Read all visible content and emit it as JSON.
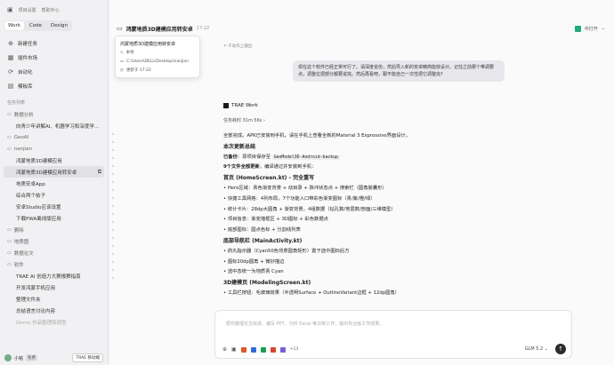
{
  "sidebar": {
    "top_text_1": "项目设置",
    "top_text_2": "帮助中心",
    "modes": [
      "Work",
      "Code",
      "Design"
    ],
    "nav": [
      {
        "label": "新建任务",
        "icon": "new-task-icon",
        "glyph": "⊕"
      },
      {
        "label": "插件市场",
        "icon": "plugin-market-icon",
        "glyph": "▦"
      },
      {
        "label": "自动化",
        "icon": "automation-icon",
        "glyph": "⟳"
      },
      {
        "label": "模板库",
        "icon": "template-icon",
        "glyph": "▤"
      }
    ],
    "list_title": "任务列表",
    "groups": [
      {
        "name": "数据分析",
        "items": [
          "向青少年讲解AI、机器学习和深度学..."
        ]
      },
      {
        "name": "GeoAI",
        "items": []
      },
      {
        "name": "nanjian",
        "items": [
          "鸿蒙地质3D建模应用",
          "鸿蒙地质3D建模应用转安卓",
          "地质安卓App",
          "综合两个帖子",
          "安卓Studio应该设置",
          "下载PWA离线版应用"
        ]
      },
      {
        "name": "删除",
        "items": []
      },
      {
        "name": "地质图",
        "items": []
      },
      {
        "name": "数据论文",
        "items": []
      },
      {
        "name": "软件",
        "items": [
          "TRAE AI 创造力大赛报赛指南",
          "开发鸿蒙手机应用",
          "整理文件夹",
          "总结语言讨论内容",
          "Demo 作品整理和调查"
        ]
      }
    ],
    "active_item": "鸿蒙地质3D建模应用转安卓",
    "user": "小铭",
    "user_badge": "免费",
    "plan_button": "TRAE 移动端"
  },
  "header": {
    "title": "鸿蒙地质3D建模应用转安卓",
    "time": "17:22",
    "open_label": "中打开"
  },
  "tooltip": {
    "title": "鸿蒙地质3D建模应用转安卓",
    "location": "本地",
    "path": "C:\\Users\\DELL\\Desktop\\nanjian",
    "updated": "更新于 17:22"
  },
  "chat": {
    "undo": "↶ 干动作上输出",
    "user_message": "现在这个软件已经正常可行了。请深度省份，然后导入新的安卓精简能效设计。记住之前那个带调要点，调整位把部分都要说完。然后再看吧，跟不能自己一次性把它调整完?",
    "assistant": "TRAE Work",
    "duration": "任务耗时 31m 56s ›",
    "intro": "全部完成。APK已安装到手机，请在手机上查看全新的Material 3 Expressive界面设计。",
    "h_summary": "本次更新总结",
    "pushed_label": "已备份",
    "pushed_text": "：原项目保存至",
    "pushed_code": "GeoModel3D-Android-backup",
    "files_label": "9个文件全部更新",
    "files_text": "，编译通过并安装到手机：",
    "h_home": "首页 (HomeScreen.kt) - 完全重写",
    "home_items": [
      "Hero区域：青色渐变背景 + 动目录 + 脉冲状态点 + 搜索栏（圆角胶囊形）",
      "快捷工具网格：4列布局，7个功能入口带彩色渐变图标（青/紫/橙/绿）",
      "统计卡片：28dp大圆角 + 渐变背景，4组数据（钻孔数/地层数/剖面/三维模型）",
      "项目信息：渐变描框区 + 3D图标 + 彩色数据点",
      "底部图标：圆点色标 + 分割线列表"
    ],
    "h_nav": "底部导航栏 (MainActivity.kt)",
    "nav_items": [
      "药丸指示器（Cyan50色背景圆角矩形）置于选中图标后方",
      "图标20dp圆角 + 微妙描边",
      "选中态统一为地质青 Cyan"
    ],
    "h_model": "3D建模页 (ModelingScreen.kt)",
    "model_items": [
      "工具栏按钮：毛玻璃效果（半透明Surface + OutlineVariant边框 + 12dp圆角）"
    ]
  },
  "composer": {
    "placeholder": "帮你整理论文综述、编写 PPT、分析 Excel 等日常工作，输出专业级工作成果。",
    "more_count": "+13",
    "model": "GLM 5.2 ⌄"
  }
}
